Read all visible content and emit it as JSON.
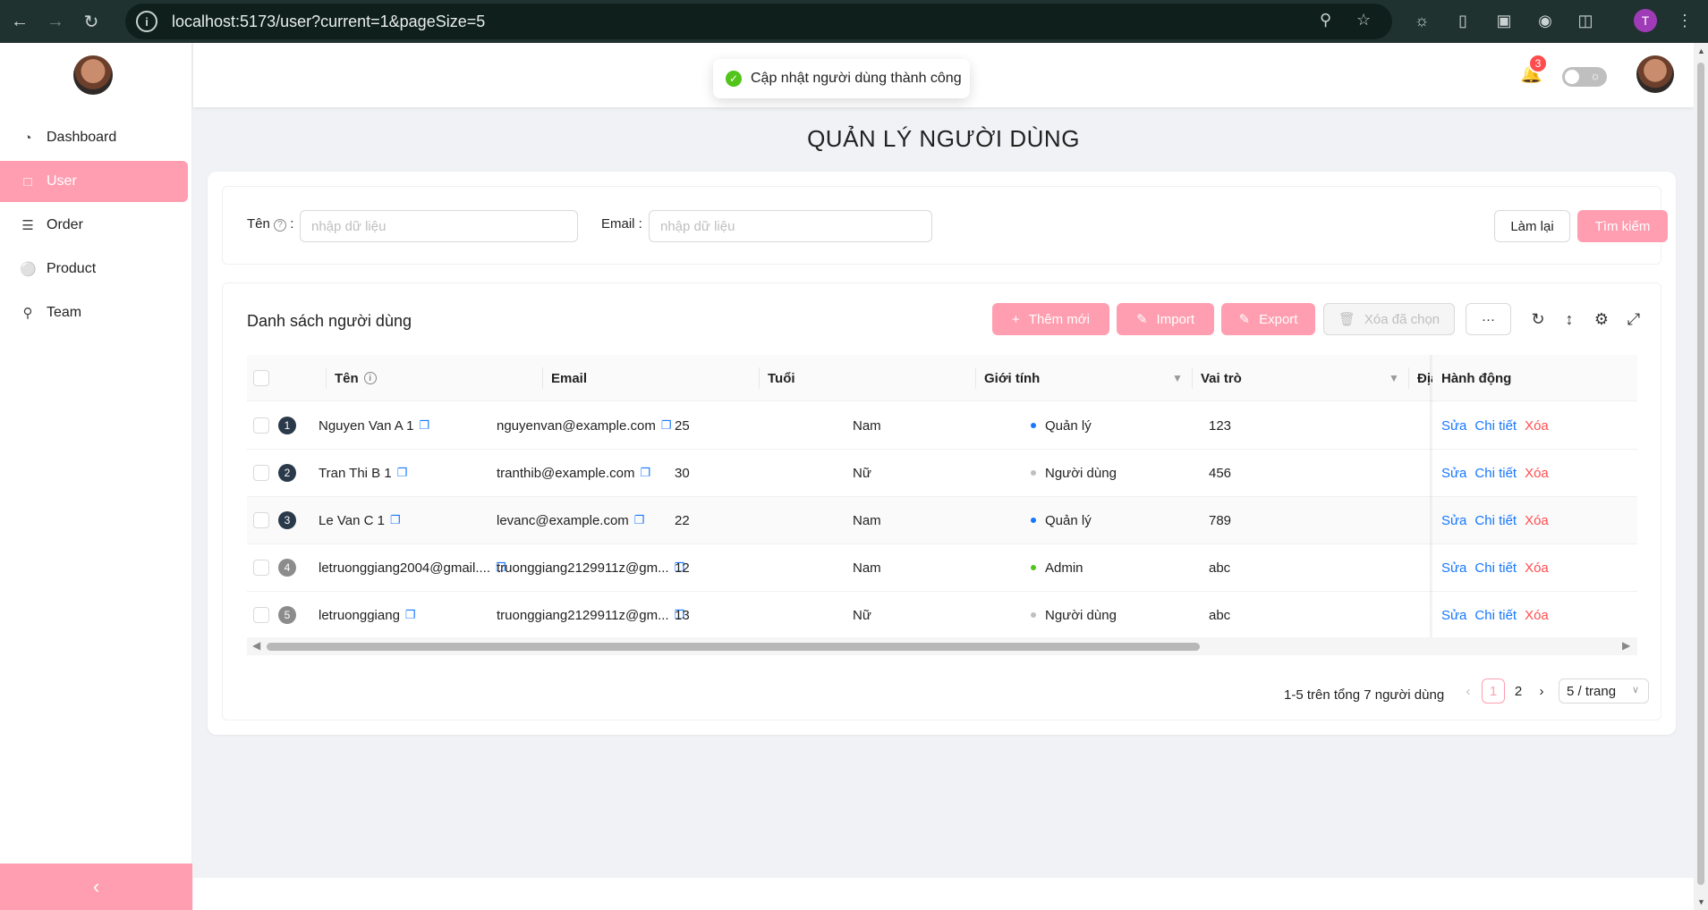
{
  "browser": {
    "url": "localhost:5173/user?current=1&pageSize=5",
    "profile_initial": "T"
  },
  "sidebar": {
    "items": [
      {
        "label": "Dashboard",
        "icon": "pie-chart-icon"
      },
      {
        "label": "User",
        "icon": "file-icon"
      },
      {
        "label": "Order",
        "icon": "list-icon"
      },
      {
        "label": "Product",
        "icon": "user-icon"
      },
      {
        "label": "Team",
        "icon": "team-icon"
      }
    ],
    "active": "User"
  },
  "header": {
    "notification_count": "3"
  },
  "toast": {
    "message": "Cập nhật người dùng thành công"
  },
  "page": {
    "title": "QUẢN LÝ NGƯỜI DÙNG"
  },
  "search": {
    "name_label": "Tên",
    "name_placeholder": "nhập dữ liệu",
    "email_label": "Email",
    "email_placeholder": "nhập dữ liệu",
    "reset_label": "Làm lại",
    "submit_label": "Tìm kiếm"
  },
  "table": {
    "title": "Danh sách người dùng",
    "toolbar": {
      "add_label": "Thêm mới",
      "import_label": "Import",
      "export_label": "Export",
      "delete_selected_label": "Xóa đã chọn",
      "more_label": "···"
    },
    "columns": {
      "name": "Tên",
      "email": "Email",
      "age": "Tuổi",
      "gender": "Giới tính",
      "role": "Vai trò",
      "address": "Địa",
      "action": "Hành động"
    },
    "rows": [
      {
        "index": "1",
        "name": "Nguyen Van A 1",
        "email": "nguyenvan@example.com",
        "age": "25",
        "gender": "Nam",
        "role": "Quản lý",
        "role_color": "#1677ff",
        "address": "123"
      },
      {
        "index": "2",
        "name": "Tran Thi B 1",
        "email": "tranthib@example.com",
        "age": "30",
        "gender": "Nữ",
        "role": "Người dùng",
        "role_color": "#bfbfbf",
        "address": "456"
      },
      {
        "index": "3",
        "name": "Le Van C 1",
        "email": "levanc@example.com",
        "age": "22",
        "gender": "Nam",
        "role": "Quản lý",
        "role_color": "#1677ff",
        "address": "789"
      },
      {
        "index": "4",
        "name": "letruonggiang2004@gmail....",
        "email": "truonggiang2129911z@gm...",
        "age": "12",
        "gender": "Nam",
        "role": "Admin",
        "role_color": "#52c41a",
        "address": "abc"
      },
      {
        "index": "5",
        "name": "letruonggiang",
        "email": "truonggiang2129911z@gm...",
        "age": "13",
        "gender": "Nữ",
        "role": "Người dùng",
        "role_color": "#bfbfbf",
        "address": "abc"
      }
    ],
    "actions": {
      "edit": "Sửa",
      "detail": "Chi tiết",
      "delete": "Xóa"
    }
  },
  "pagination": {
    "total_text": "1-5 trên tổng 7 người dùng",
    "pages": [
      "1",
      "2"
    ],
    "current": "1",
    "page_size": "5 / trang"
  },
  "colors": {
    "accent": "#ff9eb0",
    "link": "#1677ff",
    "danger": "#ff4d4f"
  }
}
